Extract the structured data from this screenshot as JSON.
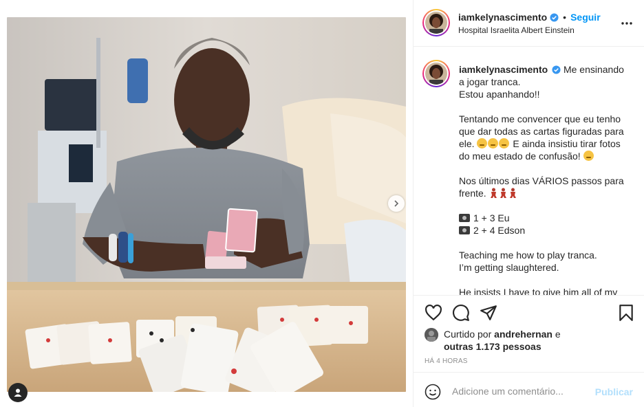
{
  "post": {
    "username": "iamkelynascimento",
    "follow_label": "Seguir",
    "separator": "•",
    "location": "Hospital Israelita Albert Einstein"
  },
  "caption": {
    "username": "iamkelynascimento",
    "line1": "Me ensinando a jogar tranca.",
    "line2": "Estou apanhando!!",
    "para2a": "Tentando me convencer que eu tenho que dar todas as cartas figuradas para ele.",
    "para2b": "E ainda insistiu tirar fotos do meu estado de confusão!",
    "para3": "Nos últimos dias VÁRIOS passos para frente.",
    "photo1": "1 + 3 Eu",
    "photo2": "2 + 4 Edson",
    "en1": "Teaching me how to play tranca.",
    "en2": "I’m getting slaughtered.",
    "en3": "He insists I have to give him all of my"
  },
  "likes": {
    "prefix": "Curtido por",
    "user": "andrehernan",
    "and": "e",
    "others": "outras 1.173 pessoas"
  },
  "timestamp": "HÁ 4 HORAS",
  "comment": {
    "placeholder": "Adicione um comentário...",
    "publish_label": "Publicar"
  },
  "icons": {
    "verified": "verified-badge-icon",
    "more": "more-options-icon",
    "like": "heart-icon",
    "comment": "comment-icon",
    "share": "share-icon",
    "save": "bookmark-icon",
    "emoji": "emoji-icon",
    "next": "chevron-right-icon",
    "tags": "user-tag-icon"
  },
  "colors": {
    "accent": "#0095f6",
    "publish_disabled": "#b2dffc",
    "verified": "#3897f0"
  }
}
